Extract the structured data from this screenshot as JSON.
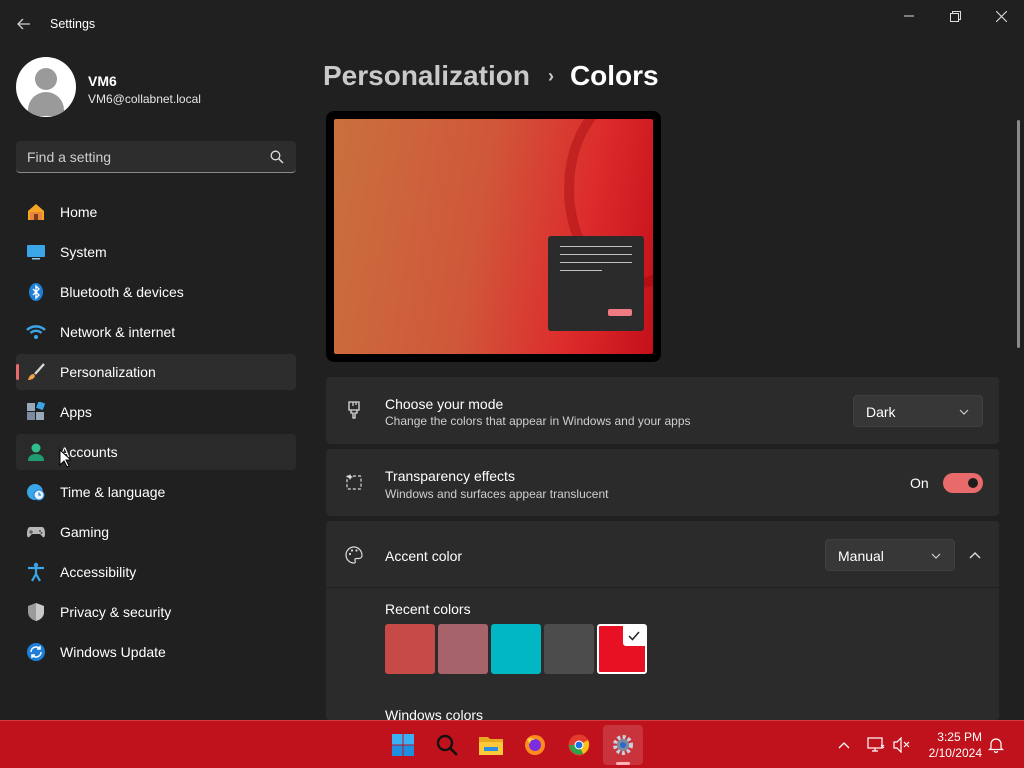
{
  "window": {
    "title": "Settings",
    "back_icon": "back-arrow-icon",
    "controls": [
      "minimize-icon",
      "restore-icon",
      "close-icon"
    ]
  },
  "user": {
    "name": "VM6",
    "email": "VM6@collabnet.local"
  },
  "search": {
    "placeholder": "Find a setting",
    "icon": "search-icon"
  },
  "nav": {
    "items": [
      {
        "label": "Home",
        "icon": "home-icon"
      },
      {
        "label": "System",
        "icon": "system-icon"
      },
      {
        "label": "Bluetooth & devices",
        "icon": "bluetooth-icon"
      },
      {
        "label": "Network & internet",
        "icon": "wifi-icon"
      },
      {
        "label": "Personalization",
        "icon": "brush-icon",
        "active": true
      },
      {
        "label": "Apps",
        "icon": "apps-icon"
      },
      {
        "label": "Accounts",
        "icon": "accounts-icon",
        "hovered": true
      },
      {
        "label": "Time & language",
        "icon": "clock-globe-icon"
      },
      {
        "label": "Gaming",
        "icon": "gamepad-icon"
      },
      {
        "label": "Accessibility",
        "icon": "accessibility-icon"
      },
      {
        "label": "Privacy & security",
        "icon": "shield-icon"
      },
      {
        "label": "Windows Update",
        "icon": "update-icon"
      }
    ]
  },
  "breadcrumb": {
    "parent": "Personalization",
    "separator": "›",
    "current": "Colors"
  },
  "settings": {
    "mode": {
      "title": "Choose your mode",
      "description": "Change the colors that appear in Windows and your apps",
      "value": "Dark",
      "icon": "paintbrush-mode-icon"
    },
    "transparency": {
      "title": "Transparency effects",
      "description": "Windows and surfaces appear translucent",
      "state_label": "On",
      "enabled": true,
      "icon": "transparency-icon"
    },
    "accent": {
      "title": "Accent color",
      "value": "Manual",
      "icon": "palette-icon",
      "expanded": true,
      "recent_label": "Recent colors",
      "recent_colors": [
        "#c64a45",
        "#a6636a",
        "#00b7c3",
        "#4c4c4c",
        "#e81123"
      ],
      "selected_index": 4,
      "windows_label": "Windows colors"
    }
  },
  "taskbar": {
    "apps": [
      "start-icon",
      "search-icon",
      "file-explorer-icon",
      "firefox-icon",
      "chrome-icon",
      "settings-icon"
    ],
    "active_app": "settings-icon",
    "tray": [
      "chevron-up-icon",
      "network-icon",
      "volume-muted-icon",
      "notification-bell-icon"
    ],
    "time": "3:25 PM",
    "date": "2/10/2024"
  },
  "colors": {
    "accent": "#e96a6a",
    "taskbar": "#c0121c",
    "background": "#202020",
    "card": "#2b2b2b"
  }
}
